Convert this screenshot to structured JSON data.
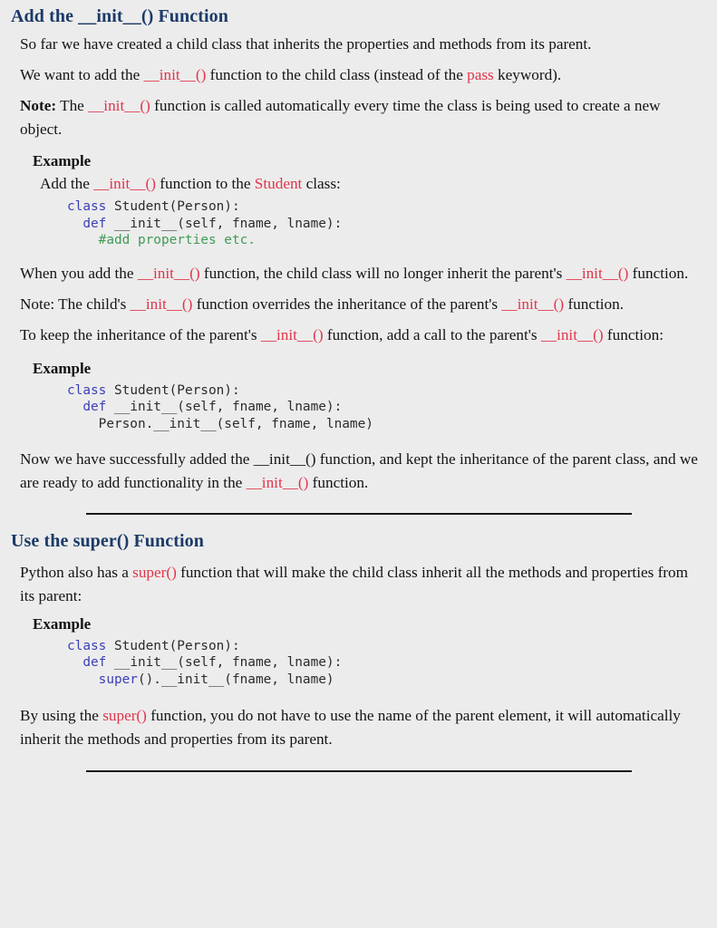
{
  "page": {
    "background_color": "#ececec",
    "heading_color": "#1b3a68",
    "accent_code_color": "#e2344a",
    "keyword_color": "#3b3fb8",
    "comment_color": "#3f9c55",
    "rule_color": "#1a1a1a"
  },
  "section1": {
    "title_pre": "Add the ",
    "title_code": "__init__()",
    "title_post": " Function",
    "p1": "So far we have created a child class that inherits the properties and methods from its parent.",
    "p2_a": "We want to add the ",
    "p2_code1": "__init__()",
    "p2_b": " function to the child class (instead of the ",
    "p2_code2": "pass",
    "p2_c": " keyword).",
    "p3_note": "Note:",
    "p3_a": " The ",
    "p3_code": "__init__()",
    "p3_b": " function is called automatically every time the class is being used to create a new object.",
    "example_label": "Example",
    "example_lead_a": "Add the ",
    "example_lead_code": "__init__()",
    "example_lead_b": " function to the ",
    "example_lead_class": "Student",
    "example_lead_c": " class:",
    "code1": [
      {
        "k": "class",
        "rest": " Student(Person):"
      },
      {
        "indent": "  ",
        "k": "def",
        "rest": " __init__(self, fname, lname):"
      },
      {
        "indent": "    ",
        "comment": "#add properties etc."
      }
    ],
    "p4_a": "When you add the ",
    "p4_code1": "__init__()",
    "p4_b": " function, the child class will no longer inherit the parent's ",
    "p4_code2": "__init__()",
    "p4_c": " function.",
    "p5_a": "Note: The child's ",
    "p5_code1": "__init__()",
    "p5_b": " function overrides the inheritance of the parent's ",
    "p5_code2": "__init__()",
    "p5_c": " function.",
    "p6_a": "To keep the inheritance of the parent's ",
    "p6_code1": "__init__()",
    "p6_b": " function, add a call to the parent's ",
    "p6_code2": "__init__()",
    "p6_c": " function:",
    "example2_label": "Example",
    "code2": [
      {
        "k": "class",
        "rest": " Student(Person):"
      },
      {
        "indent": "  ",
        "k": "def",
        "rest": " __init__(self, fname, lname):"
      },
      {
        "indent": "    ",
        "plain": "Person.__init__(self, fname, lname)"
      }
    ],
    "p7_a": "Now we have successfully added the ",
    "p7_code_black": "__init__()",
    "p7_b": " function, and kept the inheritance of the parent class, and we are ready to add functionality in the ",
    "p7_code_red": "__init__()",
    "p7_c": " function."
  },
  "section2": {
    "title": "Use the super() Function",
    "p1_a": "Python also has a ",
    "p1_code": "super()",
    "p1_b": " function that will make the child class inherit all the methods and properties from its parent:",
    "example_label": "Example",
    "code": [
      {
        "k": "class",
        "rest": " Student(Person):"
      },
      {
        "indent": "  ",
        "k": "def",
        "rest": " __init__(self, fname, lname):"
      },
      {
        "indent": "    ",
        "k": "super",
        "rest": "().__init__(fname, lname)"
      }
    ],
    "p2_a": "By using the ",
    "p2_code": "super()",
    "p2_b": " function, you do not have to use the name of the parent element, it will automatically inherit the methods and properties from its parent."
  }
}
